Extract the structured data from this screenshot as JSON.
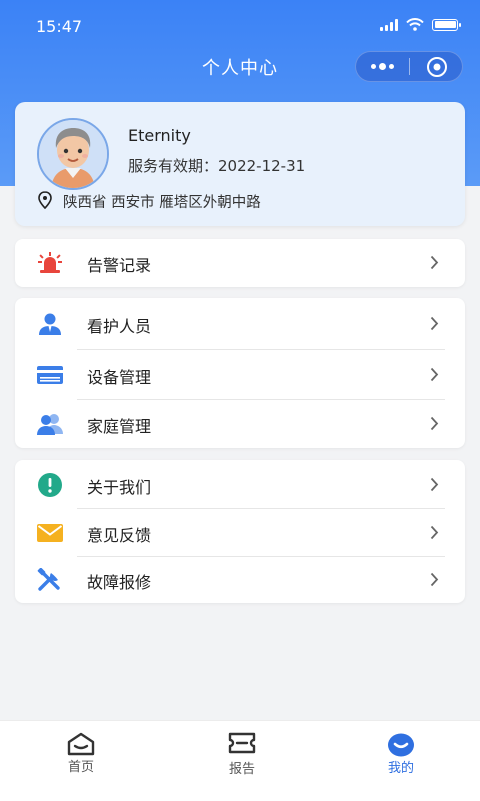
{
  "status_bar": {
    "time": "15:47"
  },
  "nav": {
    "title": "个人中心"
  },
  "profile": {
    "name": "Eternity",
    "validity": "服务有效期：2022-12-31",
    "location": "陕西省 西安市 雁塔区外朝中路"
  },
  "group1": {
    "items": [
      {
        "label": "告警记录",
        "icon": "alarm-light-icon"
      }
    ]
  },
  "group2": {
    "items": [
      {
        "label": "看护人员",
        "icon": "caregiver-icon"
      },
      {
        "label": "设备管理",
        "icon": "device-card-icon"
      },
      {
        "label": "家庭管理",
        "icon": "family-icon"
      }
    ]
  },
  "group3": {
    "items": [
      {
        "label": "关于我们",
        "icon": "info-icon"
      },
      {
        "label": "意见反馈",
        "icon": "mail-icon"
      },
      {
        "label": "故障报修",
        "icon": "tools-icon"
      }
    ]
  },
  "tabbar": {
    "tabs": [
      {
        "label": "首页",
        "icon": "home-icon"
      },
      {
        "label": "报告",
        "icon": "ticket-icon"
      },
      {
        "label": "我的",
        "icon": "smile-icon",
        "active": true
      }
    ]
  },
  "colors": {
    "primary": "#3b82f6",
    "active_tab": "#2f6fe0",
    "alarm": "#e8453c",
    "info": "#22a98a",
    "mail": "#f5b120",
    "icon_blue": "#3b7ee8"
  }
}
